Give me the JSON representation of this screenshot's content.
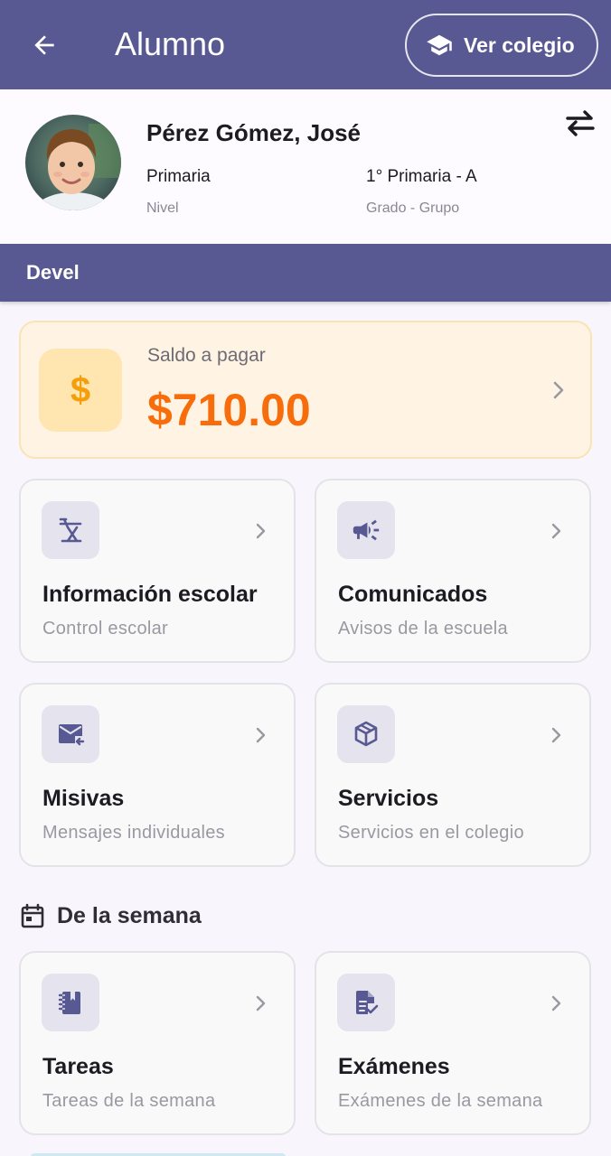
{
  "appbar": {
    "title": "Alumno",
    "school_button_label": "Ver colegio"
  },
  "student": {
    "name": "Pérez Gómez, José",
    "level_value": "Primaria",
    "level_label": "Nivel",
    "grade_value": "1° Primaria - A",
    "grade_label": "Grado - Grupo"
  },
  "banner": {
    "text": "Devel"
  },
  "balance": {
    "label": "Saldo a pagar",
    "amount": "$710.00",
    "icon_symbol": "$"
  },
  "tiles": [
    {
      "title": "Información escolar",
      "subtitle": "Control escolar",
      "icon": "school-info-icon"
    },
    {
      "title": "Comunicados",
      "subtitle": "Avisos de la escuela",
      "icon": "megaphone-icon"
    },
    {
      "title": "Misivas",
      "subtitle": "Mensajes individuales",
      "icon": "mail-icon"
    },
    {
      "title": "Servicios",
      "subtitle": "Servicios en el colegio",
      "icon": "package-icon"
    }
  ],
  "week": {
    "heading": "De la semana",
    "tiles": [
      {
        "title": "Tareas",
        "subtitle": "Tareas de la semana",
        "icon": "notebook-icon"
      },
      {
        "title": "Exámenes",
        "subtitle": "Exámenes de la semana",
        "icon": "exam-doc-icon"
      }
    ]
  },
  "colors": {
    "primary": "#585893",
    "balance_amount": "#f76d0b",
    "balance_bg": "#fff4e4"
  }
}
